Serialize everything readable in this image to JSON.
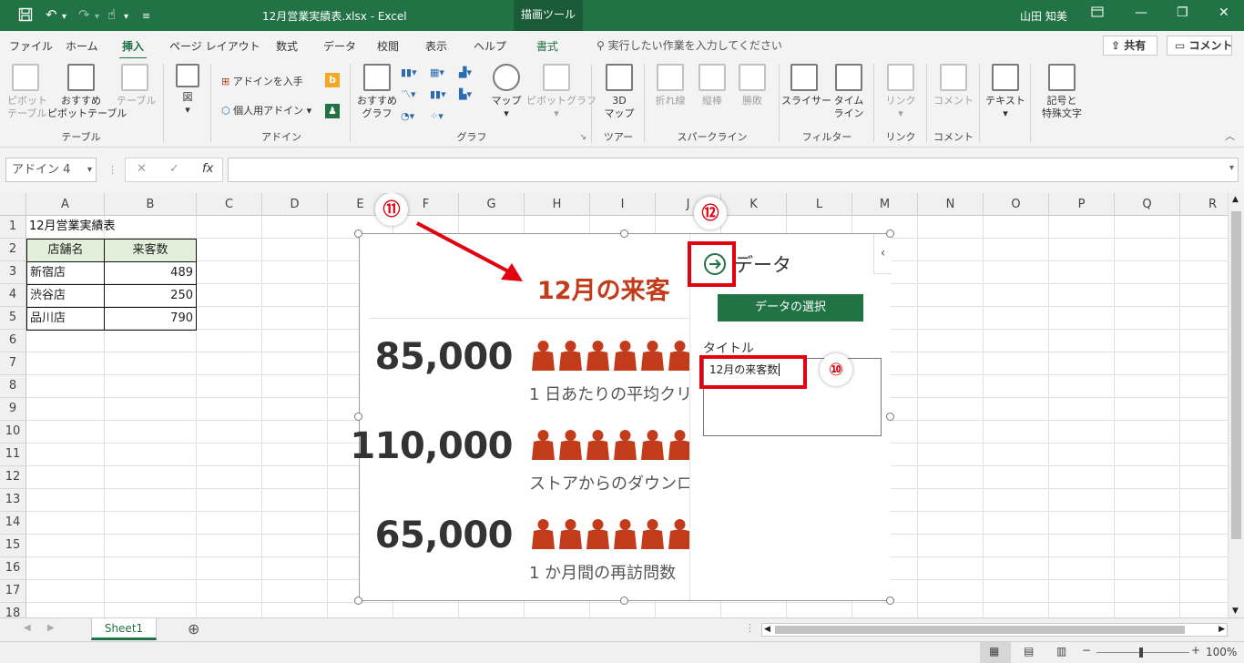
{
  "titlebar": {
    "doc_title": "12月営業実績表.xlsx - Excel",
    "contextual_tab": "描画ツール",
    "user": "山田 知美"
  },
  "menu": {
    "tabs": [
      "ファイル",
      "ホーム",
      "挿入",
      "ページ レイアウト",
      "数式",
      "データ",
      "校閲",
      "表示",
      "ヘルプ",
      "書式"
    ],
    "active_tab": "挿入",
    "tellme": "実行したい作業を入力してください",
    "share": "共有",
    "comment": "コメント"
  },
  "ribbon": {
    "groups": {
      "table": "テーブル",
      "addin": "アドイン",
      "chart": "グラフ",
      "tour": "ツアー",
      "sparkline": "スパークライン",
      "filter": "フィルター",
      "link": "リンク",
      "comment": "コメント"
    },
    "buttons": {
      "pivot_1": "ピボット",
      "pivot_2": "テーブル",
      "rec_pivot_1": "おすすめ",
      "rec_pivot_2": "ピボットテーブル",
      "table": "テーブル",
      "figure": "図",
      "get_addin": "アドインを入手",
      "my_addin": "個人用アドイン",
      "rec_chart_1": "おすすめ",
      "rec_chart_2": "グラフ",
      "map": "マップ",
      "pivot_chart": "ピボットグラフ",
      "map3d_1": "3D",
      "map3d_2": "マップ",
      "line": "折れ線",
      "column": "縦棒",
      "winloss": "勝敗",
      "slicer": "スライサー",
      "timeline_1": "タイム",
      "timeline_2": "ライン",
      "link": "リンク",
      "comment": "コメント",
      "text": "テキスト",
      "symbol_1": "記号と",
      "symbol_2": "特殊文字"
    }
  },
  "formula_bar": {
    "name_box": "アドイン 4",
    "fx": "fx",
    "value": ""
  },
  "sheet": {
    "columns": [
      "A",
      "B",
      "C",
      "D",
      "E",
      "F",
      "G",
      "H",
      "I",
      "J",
      "K",
      "L",
      "M",
      "N",
      "O",
      "P",
      "Q",
      "R"
    ],
    "rows": [
      "1",
      "2",
      "3",
      "4",
      "5",
      "6",
      "7",
      "8",
      "9",
      "10",
      "11",
      "12",
      "13",
      "14",
      "15",
      "16",
      "17",
      "18"
    ],
    "title_cell": "12月営業実績表",
    "table_headers": [
      "店舗名",
      "来客数"
    ],
    "table_rows": [
      {
        "store": "新宿店",
        "visitors": "489"
      },
      {
        "store": "渋谷店",
        "visitors": "250"
      },
      {
        "store": "品川店",
        "visitors": "790"
      }
    ],
    "sheet_tab": "Sheet1"
  },
  "addin": {
    "chart_title": "12月の来客",
    "stats": [
      {
        "value": "85,000",
        "label": "1 日あたりの平均クリ"
      },
      {
        "value": "110,000",
        "label": "ストアからのダウンロ"
      },
      {
        "value": "65,000",
        "label": "1 か月間の再訪問数"
      }
    ],
    "panel": {
      "heading": "データ",
      "select_button": "データの選択",
      "title_label": "タイトル",
      "title_value": "12月の来客数",
      "collapse": "‹"
    },
    "person_color": "#c23b1b",
    "title_color": "#c23b1b"
  },
  "annotations": {
    "badge_10": "⑩",
    "badge_11": "⑪",
    "badge_12": "⑫",
    "color": "#e3000f"
  },
  "status": {
    "zoom": "100%"
  },
  "colors": {
    "excel_green": "#217346"
  }
}
